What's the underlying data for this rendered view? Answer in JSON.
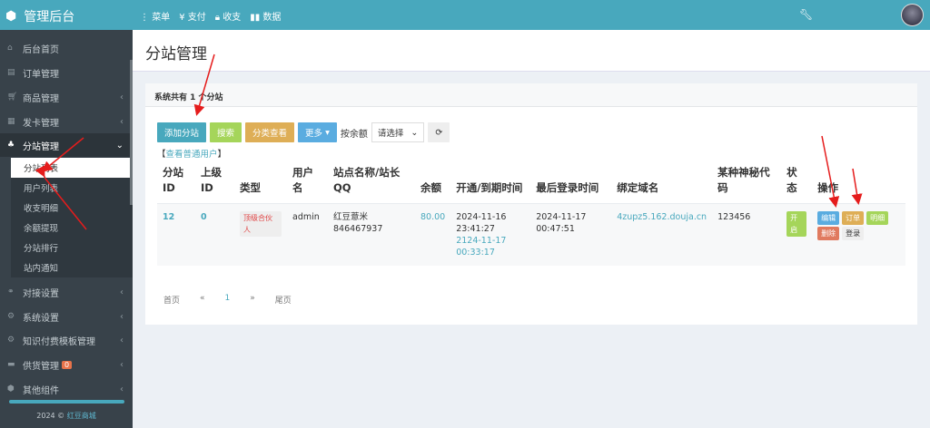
{
  "header": {
    "brand": "管理后台",
    "nav": [
      {
        "icon": "menu-icon",
        "label": "菜单"
      },
      {
        "icon": "yen-icon",
        "label": "支付"
      },
      {
        "icon": "lock-icon",
        "label": "收支"
      },
      {
        "icon": "bar-chart-icon",
        "label": "数据"
      }
    ]
  },
  "sidebar": {
    "items": [
      {
        "label": "后台首页",
        "icon": "home-icon"
      },
      {
        "label": "订单管理",
        "icon": "list-icon"
      },
      {
        "label": "商品管理",
        "icon": "cart-icon"
      },
      {
        "label": "发卡管理",
        "icon": "grid-icon"
      },
      {
        "label": "分站管理",
        "icon": "sitemap-icon"
      }
    ],
    "sub": [
      "分站列表",
      "用户列表",
      "收支明细",
      "余额提现",
      "分站排行",
      "站内通知"
    ],
    "items2": [
      {
        "label": "对接设置",
        "icon": "link-icon"
      },
      {
        "label": "系统设置",
        "icon": "gear-icon"
      },
      {
        "label": "知识付费模板管理",
        "icon": "cogs-icon"
      },
      {
        "label": "供货管理",
        "icon": "truck-icon",
        "badge": "0"
      },
      {
        "label": "其他组件",
        "icon": "cube-icon"
      }
    ],
    "footer_year": "2024 ©",
    "footer_link": "红豆商城"
  },
  "page": {
    "title": "分站管理",
    "panel_title": "系统共有 1 个分站"
  },
  "toolbar": {
    "add": "添加分站",
    "search": "搜索",
    "category": "分类查看",
    "more": "更多",
    "balance_label": "按余额",
    "balance_select": "请选择",
    "view_users": "查看普通用户"
  },
  "colors": {
    "primary": "#48a8bd",
    "green": "#a5d55a",
    "orange": "#deae56",
    "blue": "#5aace0",
    "red": "#e07a5f"
  },
  "table": {
    "headers": [
      "分站ID",
      "上级ID",
      "类型",
      "用户名",
      "站点名称/站长QQ",
      "余额",
      "开通/到期时间",
      "最后登录时间",
      "绑定域名",
      "某种神秘代码",
      "状态",
      "操作"
    ],
    "rows": [
      {
        "id": "12",
        "parent": "0",
        "type": "顶级合伙人",
        "user": "admin",
        "site": "红豆薏米",
        "qq": "846467937",
        "balance": "80.00",
        "open": "2024-11-16 23:41:27",
        "expire": "2124-11-17 00:33:17",
        "last_login": "2024-11-17 00:47:51",
        "domain": "4zupz5.162.douja.cn",
        "code": "123456",
        "status": "开启",
        "actions": [
          "编辑",
          "订单",
          "明细",
          "删除",
          "登录"
        ]
      }
    ]
  },
  "pager": [
    "首页",
    "«",
    "1",
    "»",
    "尾页"
  ]
}
